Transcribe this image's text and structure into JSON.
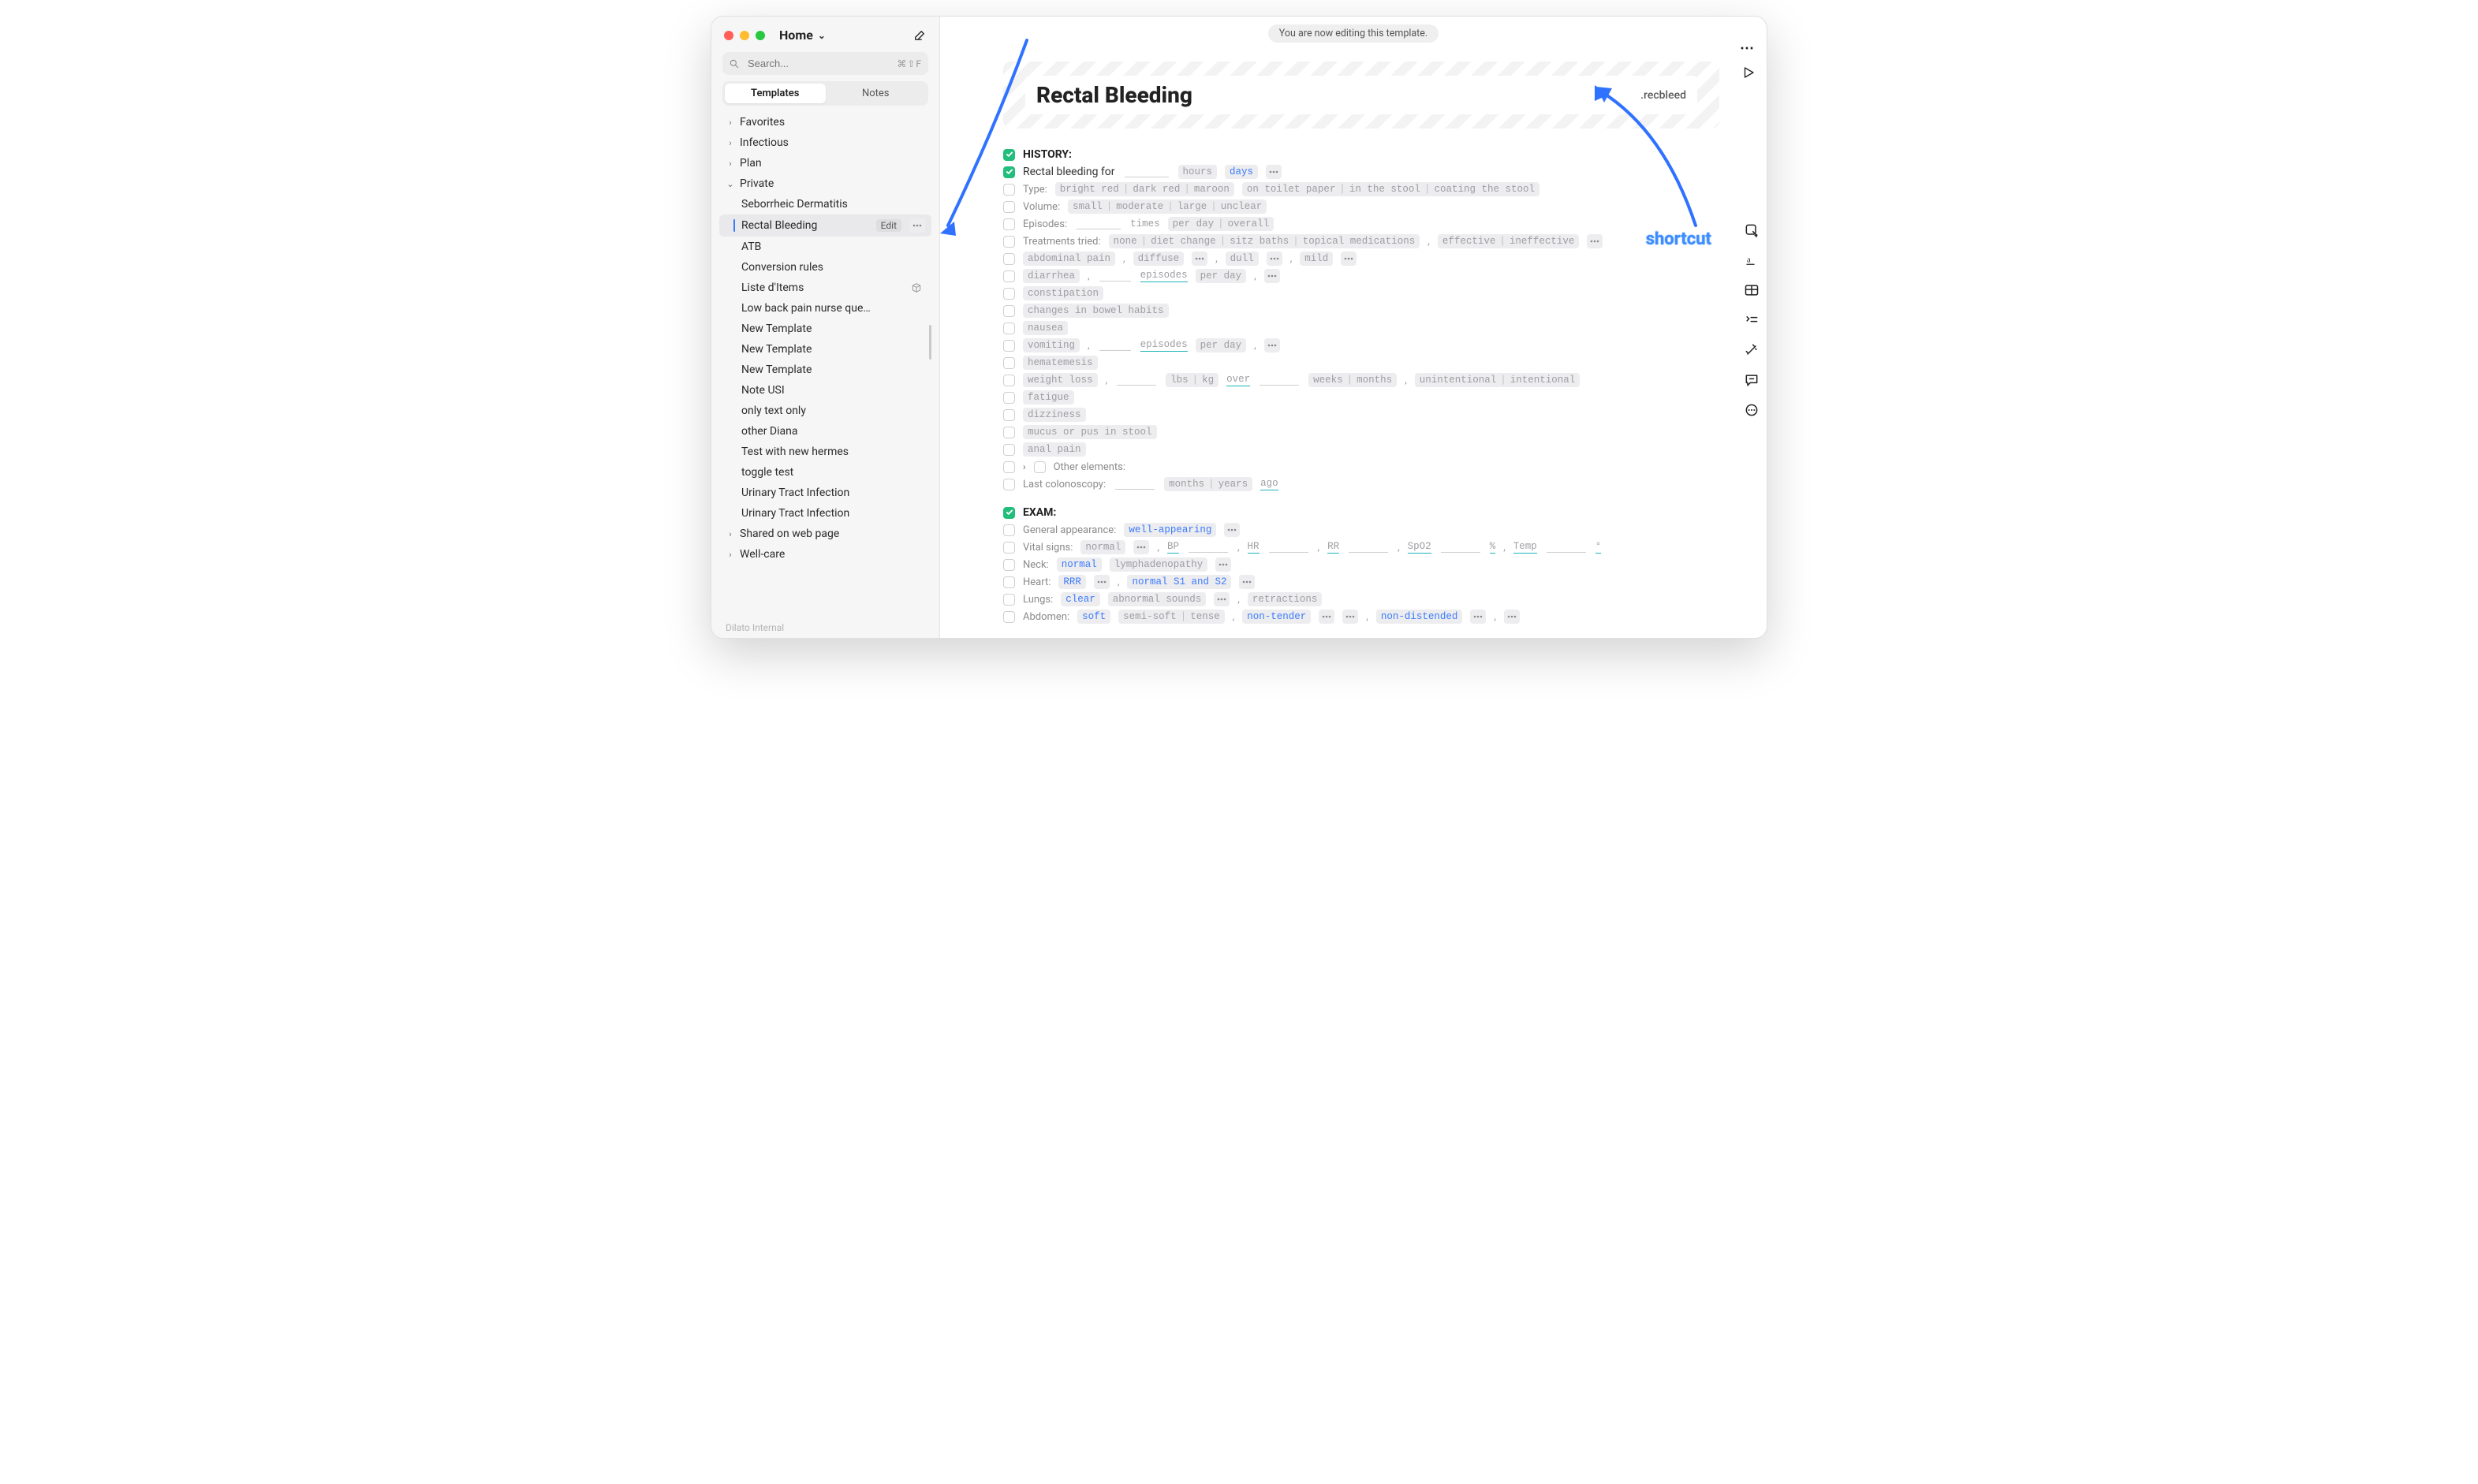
{
  "window": {
    "home_label": "Home"
  },
  "banner": {
    "text": "You are now editing this template."
  },
  "search": {
    "placeholder": "Search...",
    "shortcut": "⌘⇧F"
  },
  "segments": {
    "templates": "Templates",
    "notes": "Notes"
  },
  "sidebar": {
    "favorites": "Favorites",
    "infectious": "Infectious",
    "plan": "Plan",
    "private": "Private",
    "shared": "Shared on web page",
    "wellcare": "Well-care",
    "footer": "Dilato Internal",
    "edit_label": "Edit",
    "items": [
      "Seborrheic Dermatitis",
      "Rectal Bleeding",
      "ATB",
      "Conversion rules",
      "Liste d'Items",
      "Low back pain nurse questi...",
      "New Template",
      "New Template",
      "New Template",
      "Note USI",
      "only text only",
      "other Diana",
      "Test with new hermes",
      "toggle test",
      "Urinary Tract Infection",
      "Urinary Tract Infection"
    ]
  },
  "doc": {
    "title": "Rectal Bleeding",
    "shortcut": ".recbleed",
    "history_label": "HISTORY:",
    "exam_label": "EXAM:",
    "history": {
      "duration": {
        "label": "Rectal bleeding for",
        "hours": "hours",
        "days": "days"
      },
      "type": {
        "label": "Type:",
        "opts1": [
          "bright red",
          "dark red",
          "maroon"
        ],
        "opts2": [
          "on toilet paper",
          "in the stool",
          "coating the stool"
        ]
      },
      "volume": {
        "label": "Volume:",
        "opts": [
          "small",
          "moderate",
          "large",
          "unclear"
        ]
      },
      "episodes": {
        "label": "Episodes:",
        "times": "times",
        "opts": [
          "per day",
          "overall"
        ]
      },
      "treatments": {
        "label": "Treatments tried:",
        "opts": [
          "none",
          "diet change",
          "sitz baths",
          "topical medications"
        ],
        "eff": [
          "effective",
          "ineffective"
        ]
      },
      "abdpain": {
        "opts": [
          "abdominal pain"
        ],
        "diffuse": "diffuse",
        "dull": "dull",
        "mild": "mild"
      },
      "diarrhea": {
        "word": "diarrhea",
        "episodes_word": "episodes",
        "perday": "per day"
      },
      "constipation": "constipation",
      "bowel": "changes in bowel habits",
      "nausea": "nausea",
      "vomiting": {
        "word": "vomiting",
        "episodes_word": "episodes",
        "perday": "per day"
      },
      "hematemesis": "hematemesis",
      "weight": {
        "word": "weight loss",
        "lbs": "lbs",
        "kg": "kg",
        "over": "over",
        "weeks": "weeks",
        "months": "months",
        "intent": [
          "unintentional",
          "intentional"
        ]
      },
      "fatigue": "fatigue",
      "dizziness": "dizziness",
      "mucus": "mucus or pus in stool",
      "analpain": "anal pain",
      "other": "Other elements:",
      "colonoscopy": {
        "label": "Last colonoscopy:",
        "months": "months",
        "years": "years",
        "ago": "ago"
      }
    },
    "exam": {
      "ga": {
        "label": "General appearance:",
        "well": "well-appearing"
      },
      "vitals": {
        "label": "Vital signs:",
        "normal": "normal",
        "bp": "BP",
        "hr": "HR",
        "rr": "RR",
        "spo2": "SpO2",
        "pct": "%",
        "temp": "Temp",
        "deg": "°"
      },
      "neck": {
        "label": "Neck:",
        "normal": "normal",
        "lymph": "lymphadenopathy"
      },
      "heart": {
        "label": "Heart:",
        "rrr": "RRR",
        "s1s2": "normal S1 and S2"
      },
      "lungs": {
        "label": "Lungs:",
        "clear": "clear",
        "abn": "abnormal sounds",
        "retr": "retractions"
      },
      "abdomen": {
        "label": "Abdomen:",
        "soft": "soft",
        "semisoft": "semi-soft",
        "tense": "tense",
        "nontender": "non-tender",
        "nondist": "non-distended"
      }
    }
  },
  "annotation": {
    "shortcut": "shortcut"
  }
}
